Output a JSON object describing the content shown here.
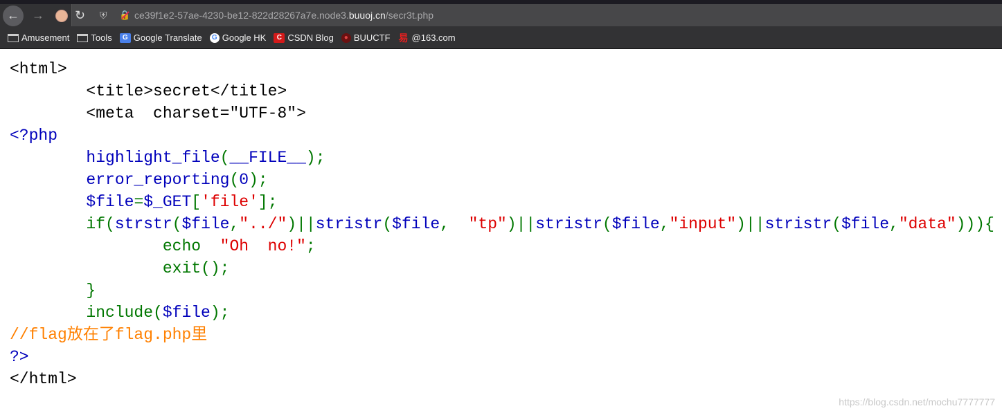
{
  "browser": {
    "url_prefix": "ce39f1e2-57ae-4230-be12-822d28267a7e.node3.",
    "url_host": "buuoj.cn",
    "url_path": "/secr3t.php",
    "icons": {
      "back": "arrow-left-icon",
      "forward": "arrow-right-icon",
      "reload": "reload-icon",
      "shield": "shield-icon",
      "insecure": "insecure-lock-icon"
    },
    "bookmarks": [
      {
        "label": "Amusement",
        "icon": "folder-icon"
      },
      {
        "label": "Tools",
        "icon": "folder-icon"
      },
      {
        "label": "Google Translate",
        "icon": "google-translate-icon"
      },
      {
        "label": "Google HK",
        "icon": "google-icon"
      },
      {
        "label": "CSDN Blog",
        "icon": "csdn-icon"
      },
      {
        "label": "BUUCTF",
        "icon": "buuctf-icon"
      },
      {
        "label": "@163.com",
        "icon": "netease-icon"
      }
    ]
  },
  "colors": {
    "html": "#000000",
    "default": "#0000BB",
    "keyword": "#007700",
    "string": "#DD0000",
    "comment": "#FF8000"
  },
  "code_lines": [
    [
      [
        "html",
        "<html>"
      ]
    ],
    [
      [
        "html",
        "        <title>secret</title>"
      ]
    ],
    [
      [
        "html",
        "        <meta  charset=\"UTF-8\">"
      ]
    ],
    [
      [
        "default",
        "<?php"
      ]
    ],
    [
      [
        "default",
        "        highlight_file"
      ],
      [
        "keyword",
        "("
      ],
      [
        "default",
        "__FILE__"
      ],
      [
        "keyword",
        ");"
      ]
    ],
    [
      [
        "default",
        "        error_reporting"
      ],
      [
        "keyword",
        "("
      ],
      [
        "default",
        "0"
      ],
      [
        "keyword",
        ");"
      ]
    ],
    [
      [
        "default",
        "        $file"
      ],
      [
        "keyword",
        "="
      ],
      [
        "default",
        "$_GET"
      ],
      [
        "keyword",
        "["
      ],
      [
        "string",
        "'file'"
      ],
      [
        "keyword",
        "];"
      ]
    ],
    [
      [
        "keyword",
        "        if("
      ],
      [
        "default",
        "strstr"
      ],
      [
        "keyword",
        "("
      ],
      [
        "default",
        "$file"
      ],
      [
        "keyword",
        ","
      ],
      [
        "string",
        "\"../\""
      ],
      [
        "keyword",
        ")||"
      ],
      [
        "default",
        "stristr"
      ],
      [
        "keyword",
        "("
      ],
      [
        "default",
        "$file"
      ],
      [
        "keyword",
        ",  "
      ],
      [
        "string",
        "\"tp\""
      ],
      [
        "keyword",
        ")||"
      ],
      [
        "default",
        "stristr"
      ],
      [
        "keyword",
        "("
      ],
      [
        "default",
        "$file"
      ],
      [
        "keyword",
        ","
      ],
      [
        "string",
        "\"input\""
      ],
      [
        "keyword",
        ")||"
      ],
      [
        "default",
        "stristr"
      ],
      [
        "keyword",
        "("
      ],
      [
        "default",
        "$file"
      ],
      [
        "keyword",
        ","
      ],
      [
        "string",
        "\"data\""
      ],
      [
        "keyword",
        "))){"
      ]
    ],
    [
      [
        "keyword",
        "                echo  "
      ],
      [
        "string",
        "\"Oh  no!\""
      ],
      [
        "keyword",
        ";"
      ]
    ],
    [
      [
        "keyword",
        "                exit();"
      ]
    ],
    [
      [
        "keyword",
        "        }"
      ]
    ],
    [
      [
        "keyword",
        "        include("
      ],
      [
        "default",
        "$file"
      ],
      [
        "keyword",
        ");"
      ]
    ],
    [
      [
        "comment",
        "//flag放在了flag.php里"
      ]
    ],
    [
      [
        "default",
        "?>"
      ]
    ],
    [
      [
        "html",
        "</html>"
      ]
    ]
  ],
  "watermark": "https://blog.csdn.net/mochu7777777"
}
